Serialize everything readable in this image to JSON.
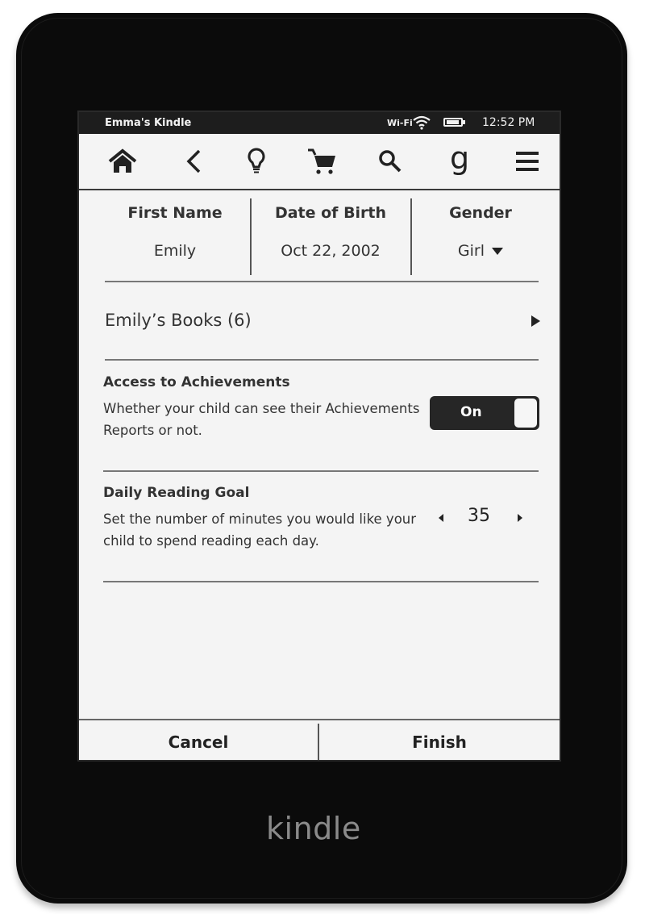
{
  "device": {
    "brand_label": "kindle"
  },
  "statusbar": {
    "device_name": "Emma's Kindle",
    "wifi_label": "Wi-Fi",
    "time": "12:52 PM"
  },
  "toolbar": {
    "icons": [
      "home-icon",
      "back-icon",
      "lightbulb-icon",
      "cart-icon",
      "search-icon",
      "goodreads-icon",
      "menu-icon"
    ],
    "goodreads_glyph": "g"
  },
  "profile": {
    "first_name_label": "First Name",
    "first_name_value": "Emily",
    "dob_label": "Date of Birth",
    "dob_value": "Oct 22, 2002",
    "gender_label": "Gender",
    "gender_value": "Girl"
  },
  "books": {
    "label": "Emily’s Books (6)"
  },
  "achievements": {
    "title": "Access to Achievements",
    "description": "Whether your child can see their Achievements Reports or not.",
    "toggle_label": "On",
    "enabled": true
  },
  "reading_goal": {
    "title": "Daily Reading Goal",
    "description": "Set the number of minutes you would like your child to spend reading each day.",
    "minutes": "35"
  },
  "footer": {
    "cancel_label": "Cancel",
    "finish_label": "Finish"
  }
}
